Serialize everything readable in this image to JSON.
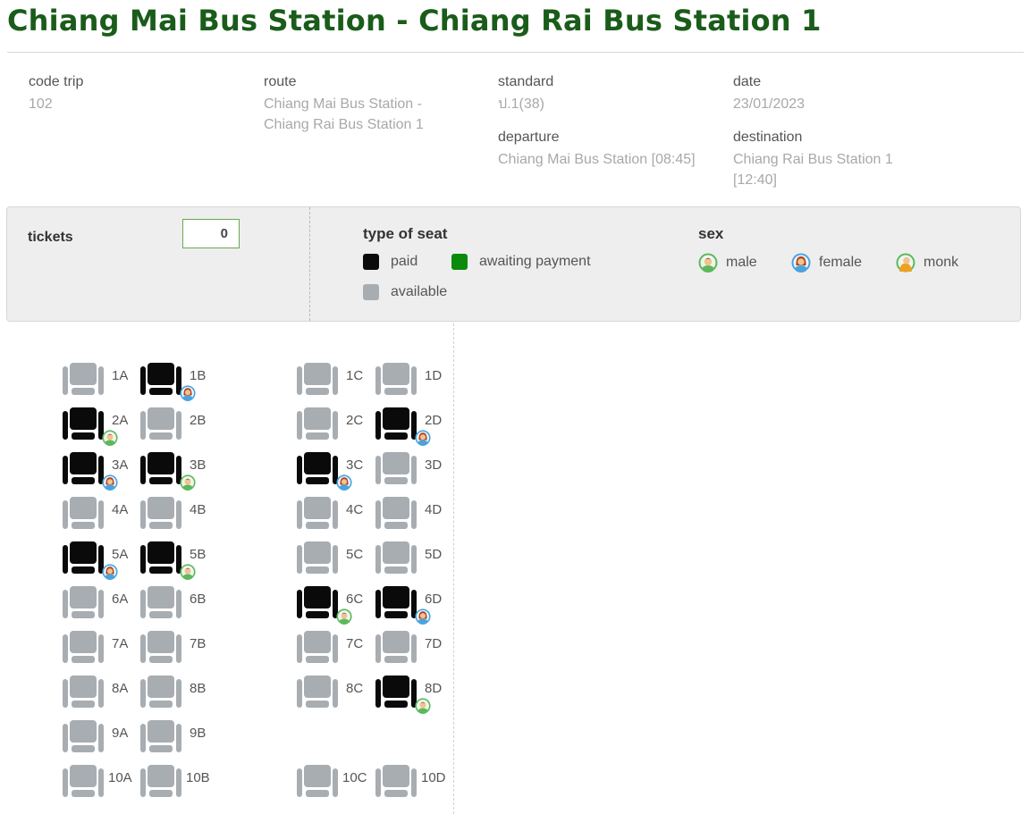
{
  "page": {
    "title": "Chiang Mai Bus Station - Chiang Rai Bus Station 1"
  },
  "trip": {
    "code_label": "code trip",
    "code_value": "102",
    "route_label": "route",
    "route_value_line1": "Chiang Mai Bus Station -",
    "route_value_line2": "Chiang Rai Bus Station 1",
    "standard_label": "standard",
    "standard_value": "ป.1(38)",
    "date_label": "date",
    "date_value": "23/01/2023",
    "departure_label": "departure",
    "departure_value": "Chiang Mai Bus Station [08:45]",
    "destination_label": "destination",
    "destination_value_line1": "Chiang Rai Bus Station 1",
    "destination_value_line2": "[12:40]"
  },
  "panel": {
    "tickets_label": "tickets",
    "tickets_value": "0",
    "seat_type_heading": "type of seat",
    "seat_types": {
      "paid": "paid",
      "awaiting": "awaiting payment",
      "available": "available"
    },
    "sex_heading": "sex",
    "sex_types": {
      "male": "male",
      "female": "female",
      "monk": "monk"
    }
  },
  "colors": {
    "paid": "#0a0a0a",
    "awaiting": "#0b8a0b",
    "available": "#a8adb2",
    "title": "#1a5c1a"
  },
  "icons": {
    "male": "male-passenger-icon",
    "female": "female-passenger-icon",
    "monk": "monk-passenger-icon",
    "seat": "seat-icon"
  },
  "seats": [
    {
      "id": "1A",
      "status": "available",
      "sex": null
    },
    {
      "id": "1B",
      "status": "paid",
      "sex": "female"
    },
    {
      "id": "1C",
      "status": "available",
      "sex": null
    },
    {
      "id": "1D",
      "status": "available",
      "sex": null
    },
    {
      "id": "2A",
      "status": "paid",
      "sex": "male"
    },
    {
      "id": "2B",
      "status": "available",
      "sex": null
    },
    {
      "id": "2C",
      "status": "available",
      "sex": null
    },
    {
      "id": "2D",
      "status": "paid",
      "sex": "female"
    },
    {
      "id": "3A",
      "status": "paid",
      "sex": "female"
    },
    {
      "id": "3B",
      "status": "paid",
      "sex": "male"
    },
    {
      "id": "3C",
      "status": "paid",
      "sex": "female"
    },
    {
      "id": "3D",
      "status": "available",
      "sex": null
    },
    {
      "id": "4A",
      "status": "available",
      "sex": null
    },
    {
      "id": "4B",
      "status": "available",
      "sex": null
    },
    {
      "id": "4C",
      "status": "available",
      "sex": null
    },
    {
      "id": "4D",
      "status": "available",
      "sex": null
    },
    {
      "id": "5A",
      "status": "paid",
      "sex": "female"
    },
    {
      "id": "5B",
      "status": "paid",
      "sex": "male"
    },
    {
      "id": "5C",
      "status": "available",
      "sex": null
    },
    {
      "id": "5D",
      "status": "available",
      "sex": null
    },
    {
      "id": "6A",
      "status": "available",
      "sex": null
    },
    {
      "id": "6B",
      "status": "available",
      "sex": null
    },
    {
      "id": "6C",
      "status": "paid",
      "sex": "male"
    },
    {
      "id": "6D",
      "status": "paid",
      "sex": "female"
    },
    {
      "id": "7A",
      "status": "available",
      "sex": null
    },
    {
      "id": "7B",
      "status": "available",
      "sex": null
    },
    {
      "id": "7C",
      "status": "available",
      "sex": null
    },
    {
      "id": "7D",
      "status": "available",
      "sex": null
    },
    {
      "id": "8A",
      "status": "available",
      "sex": null
    },
    {
      "id": "8B",
      "status": "available",
      "sex": null
    },
    {
      "id": "8C",
      "status": "available",
      "sex": null
    },
    {
      "id": "8D",
      "status": "paid",
      "sex": "male"
    },
    {
      "id": "9A",
      "status": "available",
      "sex": null
    },
    {
      "id": "9B",
      "status": "available",
      "sex": null
    },
    {
      "id": "10A",
      "status": "available",
      "sex": null
    },
    {
      "id": "10B",
      "status": "available",
      "sex": null
    },
    {
      "id": "10C",
      "status": "available",
      "sex": null
    },
    {
      "id": "10D",
      "status": "available",
      "sex": null
    }
  ]
}
